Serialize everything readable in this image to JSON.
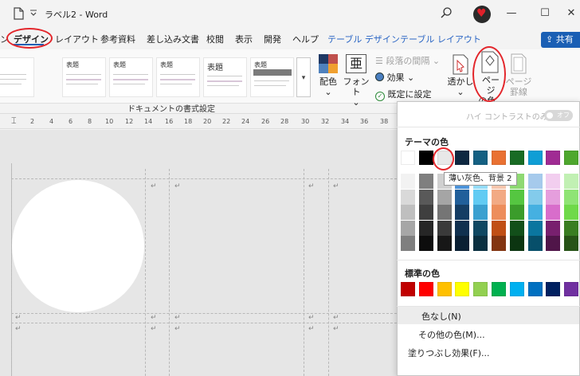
{
  "titlebar": {
    "doc_title": "ラベル2  -  Word",
    "win_min": "—",
    "win_max": "☐",
    "win_close": "✕"
  },
  "tabs": {
    "design": "デザイン",
    "layout": "レイアウト",
    "references": "参考資料",
    "mailings": "差し込み文書",
    "review": "校閲",
    "view": "表示",
    "developer": "開発",
    "help": "ヘルプ",
    "table_design": "テーブル デザイン",
    "table_layout": "テーブル レイアウト",
    "share": "共有"
  },
  "ribbon": {
    "style_gallery": [
      {
        "title": ""
      },
      {
        "title": "表題"
      },
      {
        "title": "表題"
      },
      {
        "title": "表題"
      },
      {
        "title": "表題"
      },
      {
        "title": "表題"
      }
    ],
    "colors_label": "配色",
    "fonts_label": "フォント",
    "paragraph_spacing_label": "段落の間隔",
    "effects_label": "効果",
    "set_default_label": "既定に設定",
    "watermark_label": "透かし",
    "page_color_label_1": "ページ",
    "page_color_label_2": "の色",
    "page_borders_label_1": "ページ",
    "page_borders_label_2": "罫線",
    "group_label": "ドキュメントの書式設定"
  },
  "ruler": [
    "2",
    "4",
    "6",
    "8",
    "10",
    "12",
    "14",
    "16",
    "18",
    "20",
    "22",
    "24",
    "26",
    "28",
    "30",
    "32",
    "34",
    "36",
    "38"
  ],
  "dropdown": {
    "high_contrast_label": "ハイ コントラストのみ(H)",
    "toggle_text": "オフ",
    "theme_colors_title": "テーマの色",
    "tooltip": "薄い灰色、背景 2",
    "standard_colors_title": "標準の色",
    "no_color": "色なし(N)",
    "more_colors": "その他の色(M)...",
    "fill_effects": "塗りつぶし効果(F)...",
    "theme_colors": [
      "#ffffff",
      "#000000",
      "#e8e8e8",
      "#0e2841",
      "#156082",
      "#e97132",
      "#196b24",
      "#0f9ed5",
      "#a02b93",
      "#4ea72e"
    ],
    "theme_shades": [
      [
        "#f2f2f2",
        "#d9d9d9",
        "#bfbfbf",
        "#a6a6a6",
        "#7f7f7f"
      ],
      [
        "#7f7f7f",
        "#595959",
        "#3f3f3f",
        "#262626",
        "#0d0d0d"
      ],
      [
        "#d0d0d0",
        "#a5a5a5",
        "#757575",
        "#3a3a3a",
        "#171717"
      ],
      [
        "#4d93d9",
        "#215f9a",
        "#153d64",
        "#10304f",
        "#0a1f33"
      ],
      [
        "#94dcf8",
        "#61cbf3",
        "#3aa0d0",
        "#0f4761",
        "#0a2f40"
      ],
      [
        "#f6c6ad",
        "#f2aa84",
        "#ed8e5c",
        "#c04f15",
        "#833511"
      ],
      [
        "#8ed973",
        "#55c641",
        "#3b9c2b",
        "#124f1a",
        "#0c3511"
      ],
      [
        "#a6caec",
        "#83cbeb",
        "#45b0e1",
        "#0b769f",
        "#074f6a"
      ],
      [
        "#f2ceef",
        "#e59edd",
        "#d86dcb",
        "#78206e",
        "#501549"
      ],
      [
        "#c1f0b3",
        "#8fe475",
        "#6fd94a",
        "#3a7d22",
        "#275317"
      ]
    ],
    "standard_colors": [
      "#c00000",
      "#ff0000",
      "#ffc000",
      "#ffff00",
      "#92d050",
      "#00b050",
      "#00b0f0",
      "#0070c0",
      "#002060",
      "#7030a0"
    ]
  }
}
